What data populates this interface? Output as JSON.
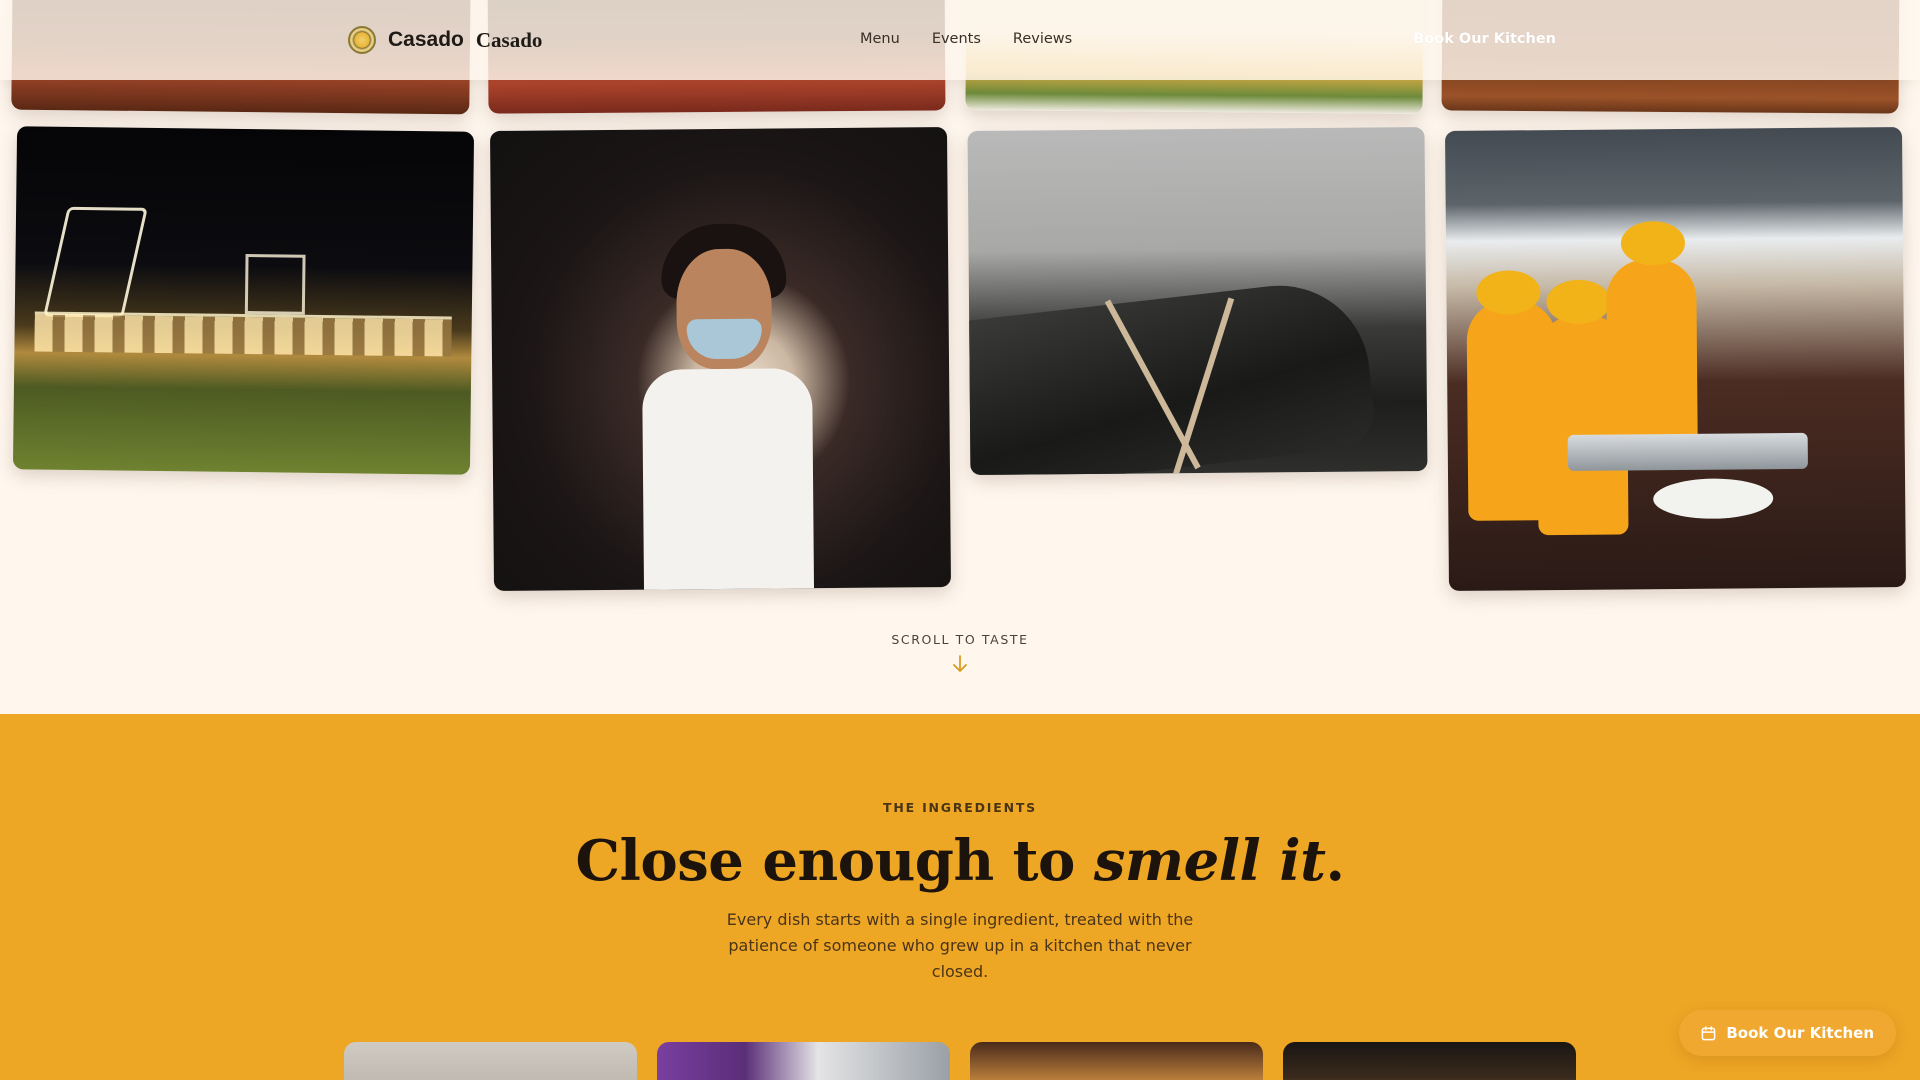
{
  "brand": {
    "name": "Casado",
    "name_serif": "Casado",
    "logo_icon": "sun-medallion-icon"
  },
  "nav": {
    "items": [
      {
        "label": "Menu"
      },
      {
        "label": "Events"
      },
      {
        "label": "Reviews"
      }
    ],
    "cta_label": "Book Our Kitchen"
  },
  "gallery": {
    "photos": [
      {
        "subject": "tomatoes-on-wood"
      },
      {
        "subject": "plated-dish-on-textile"
      },
      {
        "subject": "avocado-and-spices"
      },
      {
        "subject": "wooden-board"
      },
      {
        "subject": "night-event-stalls"
      },
      {
        "subject": "girl-at-ceremony"
      },
      {
        "subject": "leaf-wrapped-food"
      },
      {
        "subject": "caterers-serving-buffet"
      }
    ]
  },
  "scroll_cue": {
    "label": "SCROLL TO TASTE",
    "icon": "arrow-down-icon"
  },
  "ingredients": {
    "eyebrow": "THE INGREDIENTS",
    "headline_plain": "Close enough to ",
    "headline_italic": "smell it",
    "headline_end": ".",
    "lede": "Every dish starts with a single ingredient, treated with the patience of someone who grew up in a kitchen that never closed."
  },
  "floating_cta": {
    "label": "Book Our Kitchen",
    "icon": "calendar-icon"
  },
  "colors": {
    "page_bg": "#fff7ee",
    "accent": "#eea625",
    "text": "#2b2118"
  }
}
